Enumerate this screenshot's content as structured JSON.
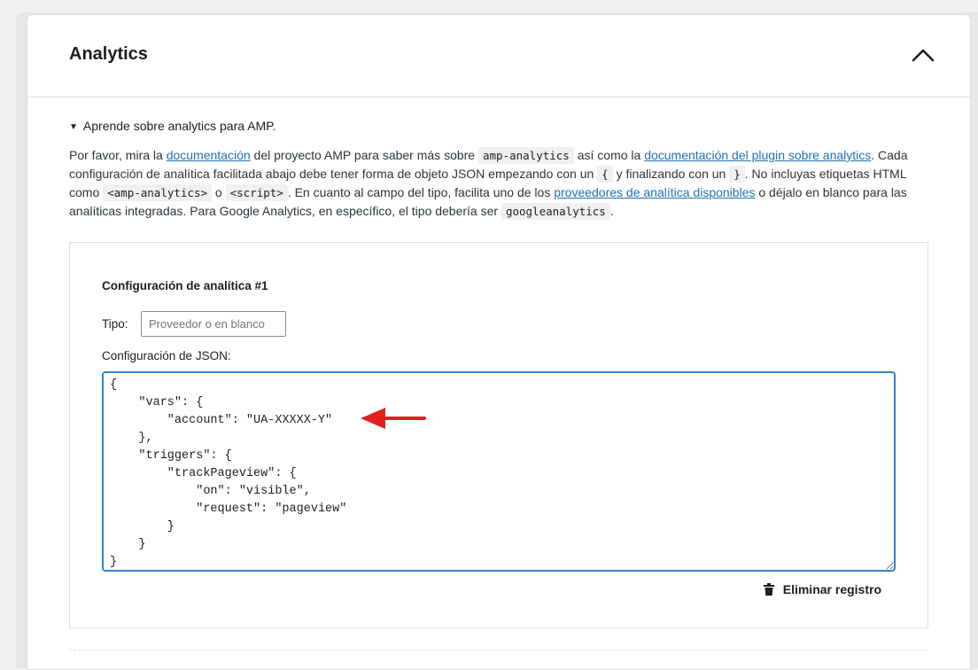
{
  "section": {
    "title": "Analytics",
    "collapse_icon": "chevron-up-icon"
  },
  "details": {
    "summary": "Aprende sobre analytics para AMP."
  },
  "description": {
    "t1": "Por favor, mira la ",
    "link1": "documentación",
    "t2": " del proyecto AMP para saber más sobre ",
    "code1": "amp-analytics",
    "t3": " así como la ",
    "link2": "documentación del plugin sobre analytics",
    "t4": ". Cada configuración de analítica facilitada abajo debe tener forma de objeto JSON empezando con un ",
    "code2": "{",
    "t5": " y finalizando con un ",
    "code3": "}",
    "t6": ". No incluyas etiquetas HTML como ",
    "code4": "<amp-analytics>",
    "t7": " o ",
    "code5": "<script>",
    "t8": ". En cuanto al campo del tipo, facilita uno de los ",
    "link3": "proveedores de analítica disponibles",
    "t9": " o déjalo en blanco para las analíticas integradas. Para Google Analytics, en específico, el tipo debería ser ",
    "code6": "googleanalytics",
    "t10": "."
  },
  "entry": {
    "title": "Configuración de analítica #1",
    "type_label": "Tipo:",
    "type_value": "",
    "type_placeholder": "Proveedor o en blanco",
    "json_label": "Configuración de JSON:",
    "json_value": "{\n    \"vars\": {\n        \"account\": \"UA-XXXXX-Y\"\n    },\n    \"triggers\": {\n        \"trackPageview\": {\n            \"on\": \"visible\",\n            \"request\": \"pageview\"\n        }\n    }\n}",
    "delete_label": "Eliminar registro",
    "delete_icon": "trash-icon"
  },
  "annotation": {
    "arrow_color": "#e02020"
  }
}
